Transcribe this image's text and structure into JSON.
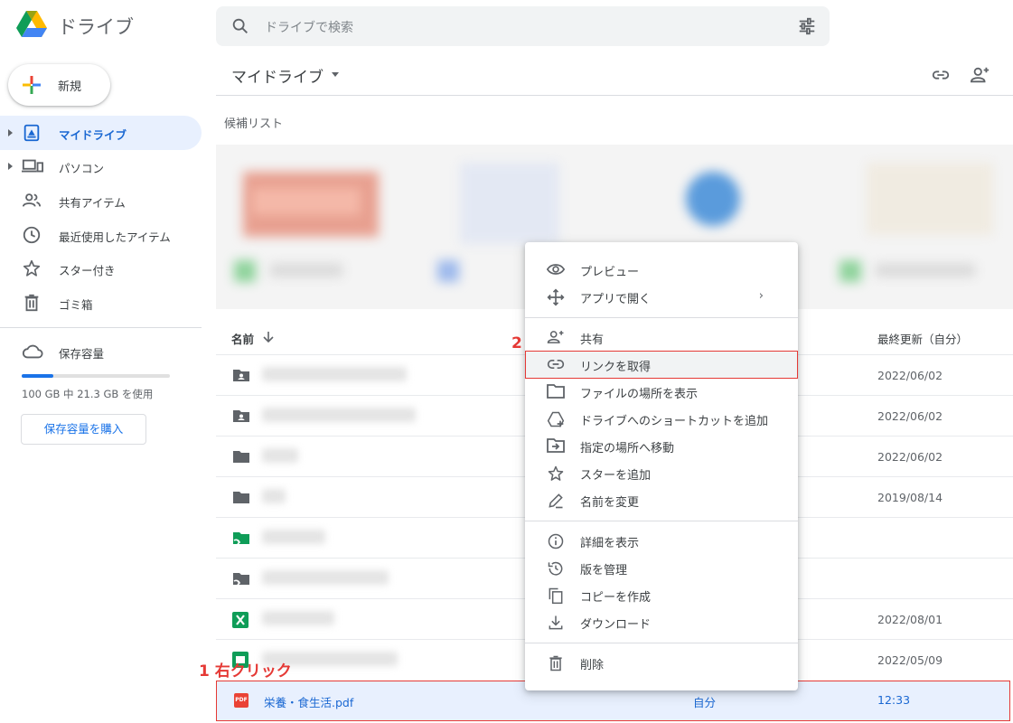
{
  "header": {
    "app_name": "ドライブ",
    "search_placeholder": "ドライブで検索"
  },
  "sidebar": {
    "new_label": "新規",
    "items": [
      {
        "label": "マイドライブ"
      },
      {
        "label": "パソコン"
      },
      {
        "label": "共有アイテム"
      },
      {
        "label": "最近使用したアイテム"
      },
      {
        "label": "スター付き"
      },
      {
        "label": "ゴミ箱"
      }
    ],
    "storage_label": "保存容量",
    "storage_used_fraction": 0.213,
    "storage_text": "100 GB 中 21.3 GB を使用",
    "buy_label": "保存容量を購入"
  },
  "main": {
    "breadcrumb": "マイドライブ",
    "suggested_title": "候補リスト",
    "col_name": "名前",
    "col_modified": "最終更新（自分）",
    "rows": [
      {
        "icon": "shared-folder-icon",
        "date": "2022/06/02"
      },
      {
        "icon": "shared-folder-icon",
        "date": "2022/06/02"
      },
      {
        "icon": "folder-icon",
        "date": "2022/06/02"
      },
      {
        "icon": "folder-icon",
        "date": "2019/08/14"
      },
      {
        "icon": "shortcut-folder-green-icon",
        "date": ""
      },
      {
        "icon": "shortcut-folder-icon",
        "date": ""
      },
      {
        "icon": "excel-icon",
        "date": "2022/08/01"
      },
      {
        "icon": "shortcut-sheet-icon",
        "date": "2022/05/09"
      }
    ],
    "selected_file": {
      "name": "栄養・食生活.pdf",
      "badge": "PDF",
      "owner": "自分",
      "modified": "12:33"
    }
  },
  "annotations": {
    "step1": "1 右クリック",
    "step2": "2"
  },
  "context_menu": {
    "items": [
      {
        "label": "プレビュー",
        "icon": "eye-icon"
      },
      {
        "label": "アプリで開く",
        "icon": "move-arrows-icon",
        "chevron": "›"
      },
      {
        "label": "共有",
        "icon": "person-add-icon"
      },
      {
        "label": "リンクを取得",
        "icon": "link-icon"
      },
      {
        "label": "ファイルの場所を表示",
        "icon": "folder-outline-icon"
      },
      {
        "label": "ドライブへのショートカットを追加",
        "icon": "drive-add-icon"
      },
      {
        "label": "指定の場所へ移動",
        "icon": "move-to-icon"
      },
      {
        "label": "スターを追加",
        "icon": "star-icon"
      },
      {
        "label": "名前を変更",
        "icon": "pencil-icon"
      },
      {
        "label": "詳細を表示",
        "icon": "info-icon"
      },
      {
        "label": "版を管理",
        "icon": "history-icon"
      },
      {
        "label": "コピーを作成",
        "icon": "copy-icon"
      },
      {
        "label": "ダウンロード",
        "icon": "download-icon"
      },
      {
        "label": "削除",
        "icon": "trash-icon"
      }
    ]
  },
  "colors": {
    "accent": "#1a73e8",
    "annotation_red": "#e53935",
    "selected_bg": "#e8f0fe"
  }
}
